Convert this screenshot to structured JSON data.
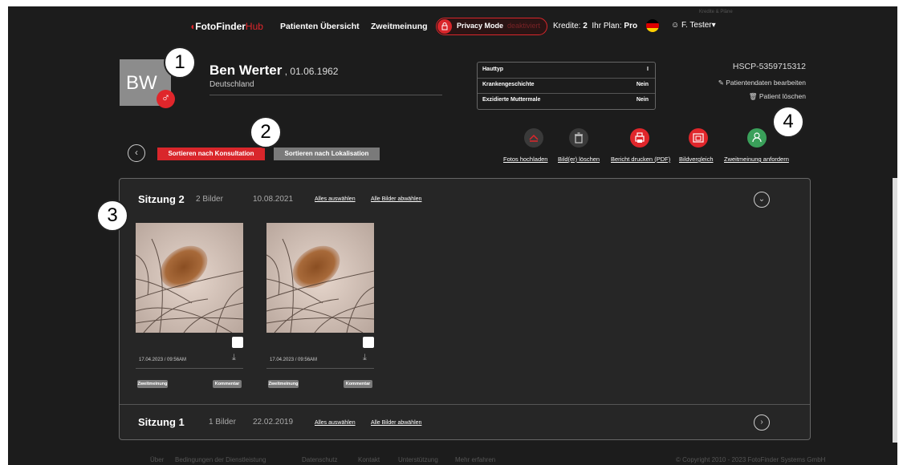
{
  "nav": {
    "logo_prefix": "Foto",
    "logo_main": "Finder",
    "logo_suffix": "Hub",
    "links": [
      "Patienten Übersicht",
      "Zweitmeinung"
    ],
    "privacy_label": "Privacy Mode",
    "privacy_state": "deaktiviert",
    "credits_label": "Kredite:",
    "credits_value": "2",
    "plan_label": "Ihr Plan:",
    "plan_value": "Pro",
    "small_header": "Kredite & Pläne",
    "user": "F. Tester"
  },
  "patient": {
    "initials": "BW",
    "gender_symbol": "♂",
    "name": "Ben Werter",
    "dob": "01.06.1962",
    "country": "Deutschland",
    "id": "HSCP-5359715312",
    "edit_label": "Patientendaten bearbeiten",
    "delete_label": "Patient löschen",
    "info": [
      {
        "label": "Hauttyp",
        "value": "I"
      },
      {
        "label": "Krankengeschichte",
        "value": "Nein"
      },
      {
        "label": "Exzidierte Muttermale",
        "value": "Nein"
      }
    ]
  },
  "callouts": [
    "1",
    "2",
    "3",
    "4"
  ],
  "sort": {
    "consultation": "Sortieren nach Konsultation",
    "localization": "Sortieren nach Lokalisation"
  },
  "actions": [
    {
      "label": "Fotos hochladen",
      "icon": "upload-icon",
      "color": "#3a3a3a"
    },
    {
      "label": "Bild(er) löschen",
      "icon": "trash-icon",
      "color": "#3a3a3a"
    },
    {
      "label": "Bericht drucken (PDF)",
      "icon": "print-icon",
      "color": "#e0262b"
    },
    {
      "label": "Bildvergleich",
      "icon": "compare-icon",
      "color": "#e0262b"
    },
    {
      "label": "Zweitmeinung anfordern",
      "icon": "user-icon",
      "color": "#3aa05a"
    }
  ],
  "sessions": [
    {
      "title": "Sitzung 2",
      "count": "2 Bilder",
      "date": "10.08.2021",
      "select_all": "Alles auswählen",
      "deselect_all": "Alle Bilder abwählen",
      "images": [
        {
          "date": "17.04.2023 / 09:56AM",
          "btn1": "Zweitmeinung",
          "btn2": "Kommentar"
        },
        {
          "date": "17.04.2023 / 09:56AM",
          "btn1": "Zweitmeinung",
          "btn2": "Kommentar"
        }
      ]
    },
    {
      "title": "Sitzung 1",
      "count": "1 Bilder",
      "date": "22.02.2019",
      "select_all": "Alles auswählen",
      "deselect_all": "Alle Bilder abwählen"
    }
  ],
  "footer": {
    "links": [
      "Über",
      "Bedingungen der Dienstleistung",
      "Datenschutz",
      "Kontakt",
      "Unterstützung",
      "Mehr erfahren"
    ],
    "copyright": "© Copyright 2010 - 2023 FotoFinder Systems GmbH"
  },
  "colors": {
    "accent": "#e0262b",
    "background": "#1c1c1c",
    "panel": "#262626",
    "green": "#3aa05a"
  }
}
